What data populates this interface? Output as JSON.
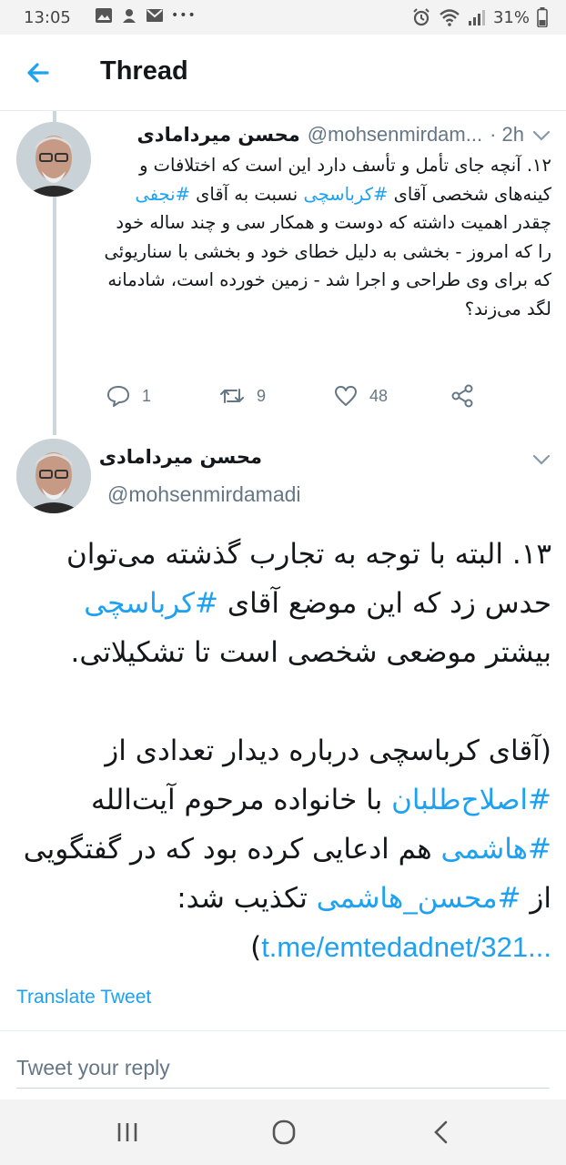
{
  "status_bar": {
    "time": "13:05",
    "battery": "31%",
    "more_dots": "•••"
  },
  "header": {
    "title": "Thread"
  },
  "tweet1": {
    "name": "محسن میردامادی",
    "handle": "@mohsenmirdam...",
    "time": "· 2h",
    "text_parts": {
      "p1": "۱۲. آنچه جای تأمل و تأسف دارد این است که اختلافات و کینه‌های شخصی آقای ",
      "h1": "#کرباسچی",
      "p2": " نسبت به آقای ",
      "h2": "#نجفی",
      "p3": " چقدر اهمیت داشته که دوست و همکار سی و چند ساله خود را که امروز - بخشی به دلیل خطای خود و بخشی با سناریوئی که برای وی طراحی و اجرا شد - زمین خورده است، شادمانه لگد می‌زند؟"
    },
    "replies": "1",
    "retweets": "9",
    "likes": "48"
  },
  "tweet2": {
    "name": "محسن میردامادی",
    "handle": "@mohsenmirdamadi",
    "text_parts": {
      "p1": "۱۳. البته با توجه به تجارب گذشته می‌توان حدس زد که این موضع آقای ",
      "h1": "#کرباسچی",
      "p2": " بیشتر موضعی شخصی است تا تشکیلاتی.",
      "p3": "(آقای کرباسچی درباره دیدار تعدادی از ",
      "h2": "#اصلاح‌طلبان",
      "p4": " با خانواده مرحوم آیت‌الله ",
      "h3": "#هاشمی",
      "p5": " هم ادعایی کرده بود که در گفتگویی از ",
      "h4": "#محسن_هاشمی",
      "p6": " تکذیب شد: ",
      "link": "t.me/emtedadnet/321...",
      "p7": ")"
    },
    "translate_label": "Translate Tweet"
  },
  "reply": {
    "placeholder": "Tweet your reply"
  },
  "colors": {
    "accent": "#1da1f2",
    "secondary_text": "#657786",
    "border": "#e6ecf0"
  }
}
